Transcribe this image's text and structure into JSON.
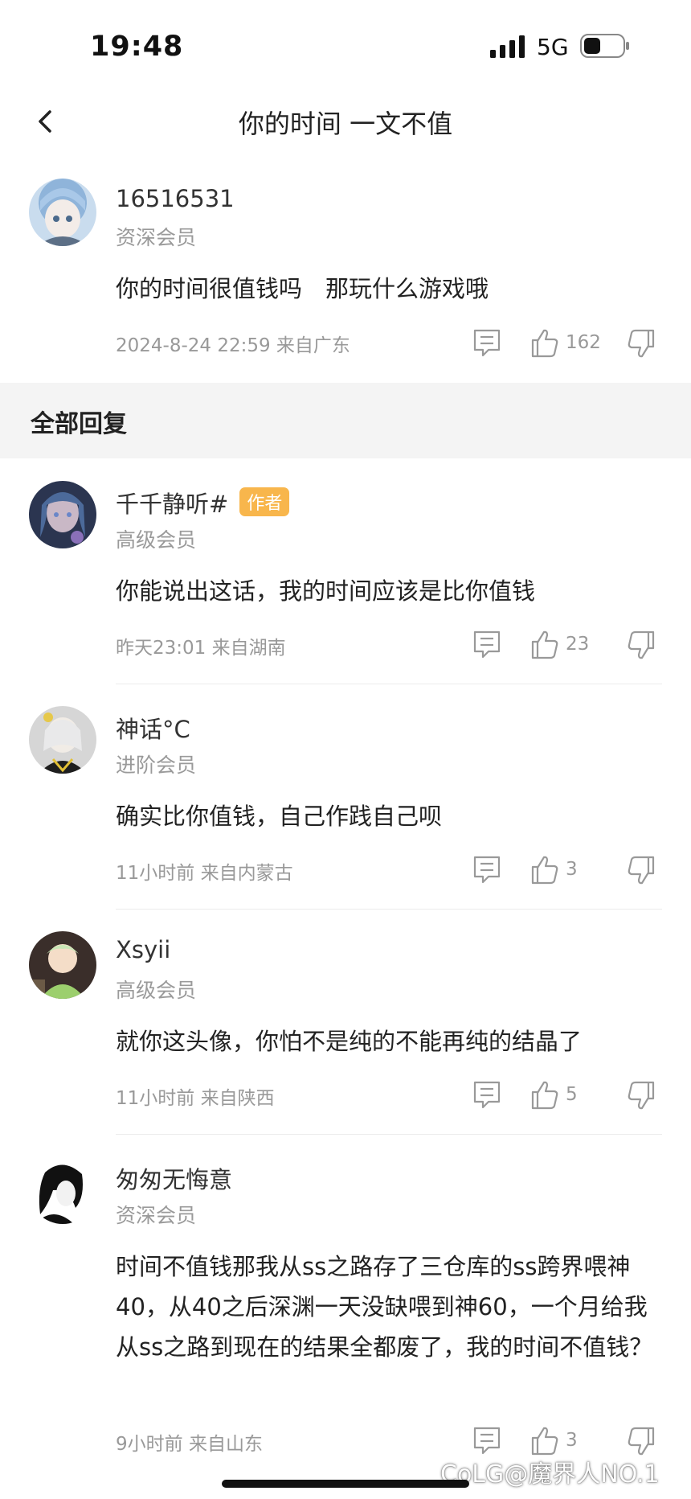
{
  "status": {
    "time": "19:48",
    "network": "5G"
  },
  "nav": {
    "title": "你的时间 一文不值"
  },
  "post": {
    "username": "16516531",
    "level": "资深会员",
    "content": "你的时间很值钱吗　那玩什么游戏哦",
    "meta": "2024-8-24 22:59 来自广东",
    "likes": "162"
  },
  "section": {
    "title": "全部回复"
  },
  "replies": [
    {
      "username": "千千静听#",
      "badge": "作者",
      "level": "高级会员",
      "content": "你能说出这话，我的时间应该是比你值钱",
      "meta": "昨天23:01 来自湖南",
      "likes": "23"
    },
    {
      "username": "神话°C",
      "level": "进阶会员",
      "content": "确实比你值钱，自己作践自己呗",
      "meta": "11小时前 来自内蒙古",
      "likes": "3"
    },
    {
      "username": "Xsyii",
      "level": "高级会员",
      "content": "就你这头像，你怕不是纯的不能再纯的结晶了",
      "meta": "11小时前 来自陕西",
      "likes": "5"
    },
    {
      "username": "匆匆无悔意",
      "level": "资深会员",
      "content": "时间不值钱那我从ss之路存了三仓库的ss跨界喂神40，从40之后深渊一天没缺喂到神60，一个月给我从ss之路到现在的结果全都废了，我的时间不值钱？",
      "meta": "9小时前 来自山东",
      "likes": "3"
    }
  ],
  "watermark": "CoLG@魔界人NO.1"
}
